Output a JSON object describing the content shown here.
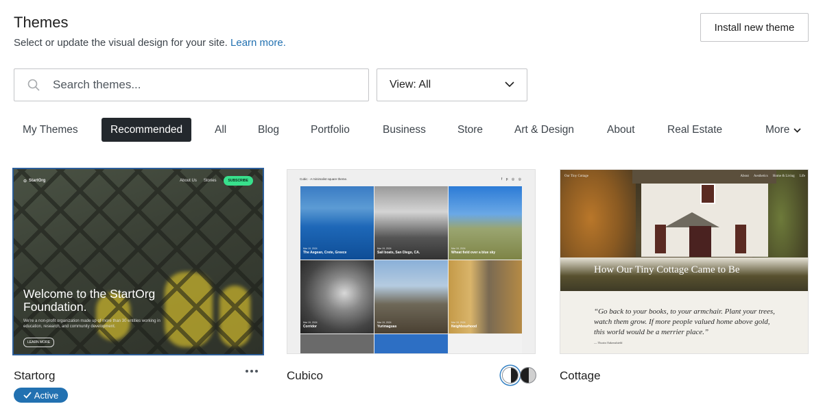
{
  "header": {
    "title": "Themes",
    "subtitle": "Select or update the visual design for your site.",
    "learn_more": "Learn more.",
    "install_button": "Install new theme"
  },
  "search": {
    "placeholder": "Search themes..."
  },
  "view_filter": {
    "label": "View: All"
  },
  "tabs": [
    {
      "label": "My Themes"
    },
    {
      "label": "Recommended",
      "active": true
    },
    {
      "label": "All"
    },
    {
      "label": "Blog"
    },
    {
      "label": "Portfolio"
    },
    {
      "label": "Business"
    },
    {
      "label": "Store"
    },
    {
      "label": "Art & Design"
    },
    {
      "label": "About"
    },
    {
      "label": "Real Estate"
    },
    {
      "label": "More"
    }
  ],
  "themes": [
    {
      "name": "Startorg",
      "active_badge": "Active",
      "preview": {
        "logo": "StartOrg",
        "nav": [
          "About Us",
          "Stories"
        ],
        "cta": "SUBSCRIBE",
        "heading": "Welcome to the StartOrg Foundation.",
        "body": "We're a non-profit organization made up of more than 30 entities working in education, research, and community development.",
        "button": "LEARN MORE"
      }
    },
    {
      "name": "Cubico",
      "preview": {
        "site_title": "Cubic · A minimalist square theme.",
        "tiles": [
          {
            "date": "Mar 19, 2024",
            "caption": "The Aegean, Crete, Greece"
          },
          {
            "date": "Mar 19, 2024",
            "caption": "Sail boats, San Diego, CA."
          },
          {
            "date": "Mar 19, 2024",
            "caption": "Wheat field over a blue sky"
          },
          {
            "date": "Mar 19, 2024",
            "caption": "Corridor"
          },
          {
            "date": "Mar 19, 2024",
            "caption": "Yurimaguas"
          },
          {
            "date": "Mar 19, 2024",
            "caption": "Neighbourhood"
          }
        ]
      }
    },
    {
      "name": "Cottage",
      "preview": {
        "site_title": "Our Tiny Cottage",
        "nav": [
          "About",
          "Aesthetics",
          "Home & Living",
          "Life"
        ],
        "post_title": "How Our Tiny Cottage Came to Be",
        "quote": "“Go back to your books, to your armchair. Plant your trees, watch them grow. If more people valued home above gold, this world would be a merrier place.”",
        "author": "— Thorin Oakenshield"
      }
    }
  ],
  "colors": {
    "accent": "#2271b1",
    "tab_active_bg": "#23282d",
    "selected_outline": "#2c5e9a"
  }
}
